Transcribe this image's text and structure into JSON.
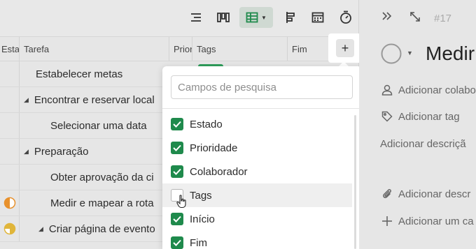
{
  "toolbar": {
    "buttons": [
      {
        "name": "list-view-icon"
      },
      {
        "name": "board-view-icon"
      },
      {
        "name": "grid-view-icon"
      },
      {
        "name": "gantt-view-icon"
      },
      {
        "name": "calendar-view-icon"
      },
      {
        "name": "timer-icon"
      }
    ]
  },
  "table": {
    "headers": [
      "Esta",
      "Tarefa",
      "Prior",
      "Tags",
      "Fim"
    ],
    "rows": [
      {
        "name": "Estabelecer metas",
        "caret": "",
        "status": ""
      },
      {
        "name": "Encontrar e reservar local",
        "caret": "◢",
        "status": ""
      },
      {
        "name": "Selecionar uma data",
        "caret": "",
        "status": ""
      },
      {
        "name": "Preparação",
        "caret": "◢",
        "status": ""
      },
      {
        "name": "Obter aprovação da ci",
        "caret": "",
        "status": ""
      },
      {
        "name": "Medir e mapear a rota",
        "caret": "",
        "status": "half"
      },
      {
        "name": "Criar página de evento",
        "caret": "◢",
        "status": "three-quarter"
      }
    ],
    "add_column_label": "+"
  },
  "dropdown": {
    "search_placeholder": "Campos de pesquisa",
    "options": [
      {
        "label": "Estado",
        "checked": true
      },
      {
        "label": "Prioridade",
        "checked": true
      },
      {
        "label": "Colaborador",
        "checked": true
      },
      {
        "label": "Tags",
        "checked": false
      },
      {
        "label": "Início",
        "checked": true
      },
      {
        "label": "Fim",
        "checked": true
      }
    ]
  },
  "detail": {
    "task_id": "#17",
    "title": "Medir",
    "add_collaborator": "Adicionar colabo",
    "add_tag": "Adicionar tag",
    "add_description": "Adicionar descriçã",
    "add_attachment": "Adicionar descr",
    "add_field": "Adicionar um ca"
  },
  "colors": {
    "accent_green": "#1f8a4c",
    "status_orange": "#e8912d",
    "status_yellow": "#e0b53a"
  }
}
